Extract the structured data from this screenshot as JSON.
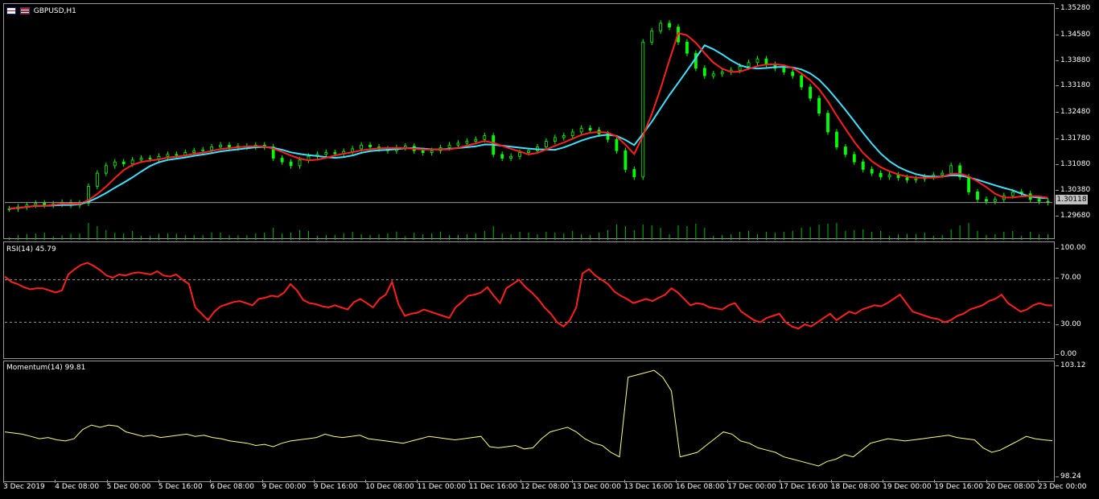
{
  "main": {
    "symbol_label": "GBPUSD,H1",
    "price_ticks": [
      "1.35280",
      "1.34580",
      "1.33880",
      "1.33180",
      "1.32480",
      "1.31780",
      "1.31080",
      "1.30380",
      "1.29680"
    ],
    "current_price": "1.30118",
    "colors": {
      "candle": "#00ff00",
      "ma_fast": "#ff2020",
      "ma_slow": "#40e0ff",
      "volume": "#00c000",
      "grid": "#9a9a9a"
    }
  },
  "rsi": {
    "label": "RSI(14) 45.79",
    "ticks": [
      "100.00",
      "70.00",
      "30.00",
      "0.00"
    ],
    "color": "#ff2020",
    "values": [
      73,
      68,
      66,
      63,
      61,
      62,
      62,
      60,
      58,
      60,
      75,
      80,
      84,
      86,
      83,
      79,
      74,
      72,
      75,
      74,
      76,
      77,
      76,
      75,
      78,
      74,
      73,
      75,
      70,
      66,
      44,
      38,
      32,
      40,
      45,
      47,
      49,
      50,
      48,
      46,
      52,
      53,
      55,
      54,
      58,
      66,
      60,
      51,
      48,
      47,
      45,
      44,
      46,
      44,
      42,
      49,
      52,
      48,
      44,
      52,
      56,
      68,
      47,
      36,
      38,
      39,
      42,
      40,
      38,
      36,
      34,
      44,
      49,
      55,
      56,
      58,
      63,
      55,
      48,
      62,
      66,
      70,
      63,
      58,
      52,
      44,
      38,
      30,
      26,
      32,
      44,
      76,
      80,
      74,
      70,
      66,
      59,
      55,
      52,
      48,
      50,
      52,
      50,
      53,
      56,
      62,
      58,
      52,
      46,
      48,
      47,
      44,
      43,
      42,
      46,
      48,
      40,
      36,
      32,
      30,
      34,
      36,
      38,
      30,
      26,
      24,
      28,
      26,
      30,
      34,
      38,
      32,
      36,
      40,
      38,
      42,
      44,
      46,
      45,
      48,
      52,
      56,
      48,
      40,
      38,
      36,
      34,
      33,
      30,
      32,
      36,
      38,
      42,
      44,
      46,
      50,
      52,
      56,
      48,
      44,
      40,
      42,
      46,
      48,
      46,
      45.79
    ],
    "levels": [
      70,
      30
    ]
  },
  "momentum": {
    "label": "Momentum(14) 99.81",
    "ticks": [
      "103.12",
      "98.24"
    ],
    "color": "#ffff80",
    "values": [
      100.2,
      100.15,
      100.1,
      100.0,
      99.9,
      99.95,
      99.85,
      99.8,
      99.9,
      100.3,
      100.5,
      100.4,
      100.5,
      100.45,
      100.2,
      100.1,
      100.0,
      100.05,
      99.95,
      100.0,
      100.05,
      100.1,
      100.0,
      100.05,
      99.95,
      99.9,
      99.8,
      99.75,
      99.7,
      99.6,
      99.65,
      99.55,
      99.7,
      99.8,
      99.85,
      99.9,
      99.95,
      100.1,
      100.0,
      99.95,
      100.0,
      100.05,
      99.9,
      99.85,
      99.8,
      99.75,
      99.7,
      99.8,
      99.9,
      100.0,
      99.95,
      99.9,
      99.85,
      99.9,
      99.95,
      100.0,
      99.55,
      99.5,
      99.55,
      99.6,
      99.45,
      99.5,
      99.9,
      100.2,
      100.3,
      100.4,
      100.2,
      99.9,
      99.7,
      99.6,
      99.3,
      99.1,
      102.6,
      102.7,
      102.8,
      102.9,
      102.6,
      102.0,
      99.1,
      99.2,
      99.3,
      99.6,
      99.9,
      100.2,
      100.1,
      99.8,
      99.7,
      99.5,
      99.4,
      99.3,
      99.1,
      99.0,
      98.9,
      98.8,
      98.7,
      98.9,
      99.0,
      99.2,
      99.1,
      99.4,
      99.7,
      99.8,
      99.9,
      99.85,
      99.8,
      99.85,
      99.9,
      99.95,
      100.0,
      100.05,
      99.95,
      99.9,
      99.85,
      99.5,
      99.3,
      99.4,
      99.6,
      99.8,
      100.0,
      99.9,
      99.85,
      99.81
    ],
    "ymin": 98.24,
    "ymax": 103.12
  },
  "timeline": [
    "3 Dec 2019",
    "4 Dec 08:00",
    "5 Dec 00:00",
    "5 Dec 16:00",
    "6 Dec 08:00",
    "9 Dec 00:00",
    "9 Dec 16:00",
    "10 Dec 08:00",
    "11 Dec 00:00",
    "11 Dec 16:00",
    "12 Dec 08:00",
    "13 Dec 00:00",
    "13 Dec 16:00",
    "16 Dec 08:00",
    "17 Dec 00:00",
    "17 Dec 16:00",
    "18 Dec 08:00",
    "19 Dec 00:00",
    "19 Dec 16:00",
    "20 Dec 08:00",
    "23 Dec 00:00"
  ],
  "price_series": {
    "ymin": 1.294,
    "ymax": 1.3535,
    "close": [
      1.2995,
      1.3,
      1.3005,
      1.301,
      1.3005,
      1.3008,
      1.3012,
      1.3005,
      1.301,
      1.3055,
      1.309,
      1.311,
      1.312,
      1.3115,
      1.3125,
      1.313,
      1.3128,
      1.3135,
      1.314,
      1.3138,
      1.3145,
      1.315,
      1.3152,
      1.316,
      1.3165,
      1.3158,
      1.3162,
      1.316,
      1.3165,
      1.316,
      1.313,
      1.312,
      1.311,
      1.3125,
      1.3135,
      1.314,
      1.3145,
      1.3142,
      1.3148,
      1.3155,
      1.3165,
      1.316,
      1.3155,
      1.315,
      1.3158,
      1.3162,
      1.315,
      1.3145,
      1.315,
      1.3158,
      1.3165,
      1.317,
      1.3175,
      1.318,
      1.319,
      1.314,
      1.313,
      1.3135,
      1.3145,
      1.315,
      1.316,
      1.3175,
      1.3185,
      1.319,
      1.32,
      1.321,
      1.3205,
      1.3195,
      1.318,
      1.315,
      1.31,
      1.308,
      1.344,
      1.347,
      1.349,
      1.348,
      1.344,
      1.341,
      1.337,
      1.335,
      1.3355,
      1.336,
      1.3365,
      1.3375,
      1.3385,
      1.3395,
      1.338,
      1.337,
      1.336,
      1.335,
      1.332,
      1.329,
      1.325,
      1.32,
      1.316,
      1.314,
      1.312,
      1.31,
      1.309,
      1.308,
      1.3085,
      1.3078,
      1.3072,
      1.3075,
      1.308,
      1.3085,
      1.309,
      1.311,
      1.308,
      1.304,
      1.302,
      1.3015,
      1.302,
      1.303,
      1.304,
      1.3035,
      1.302,
      1.3015,
      1.3012
    ]
  }
}
